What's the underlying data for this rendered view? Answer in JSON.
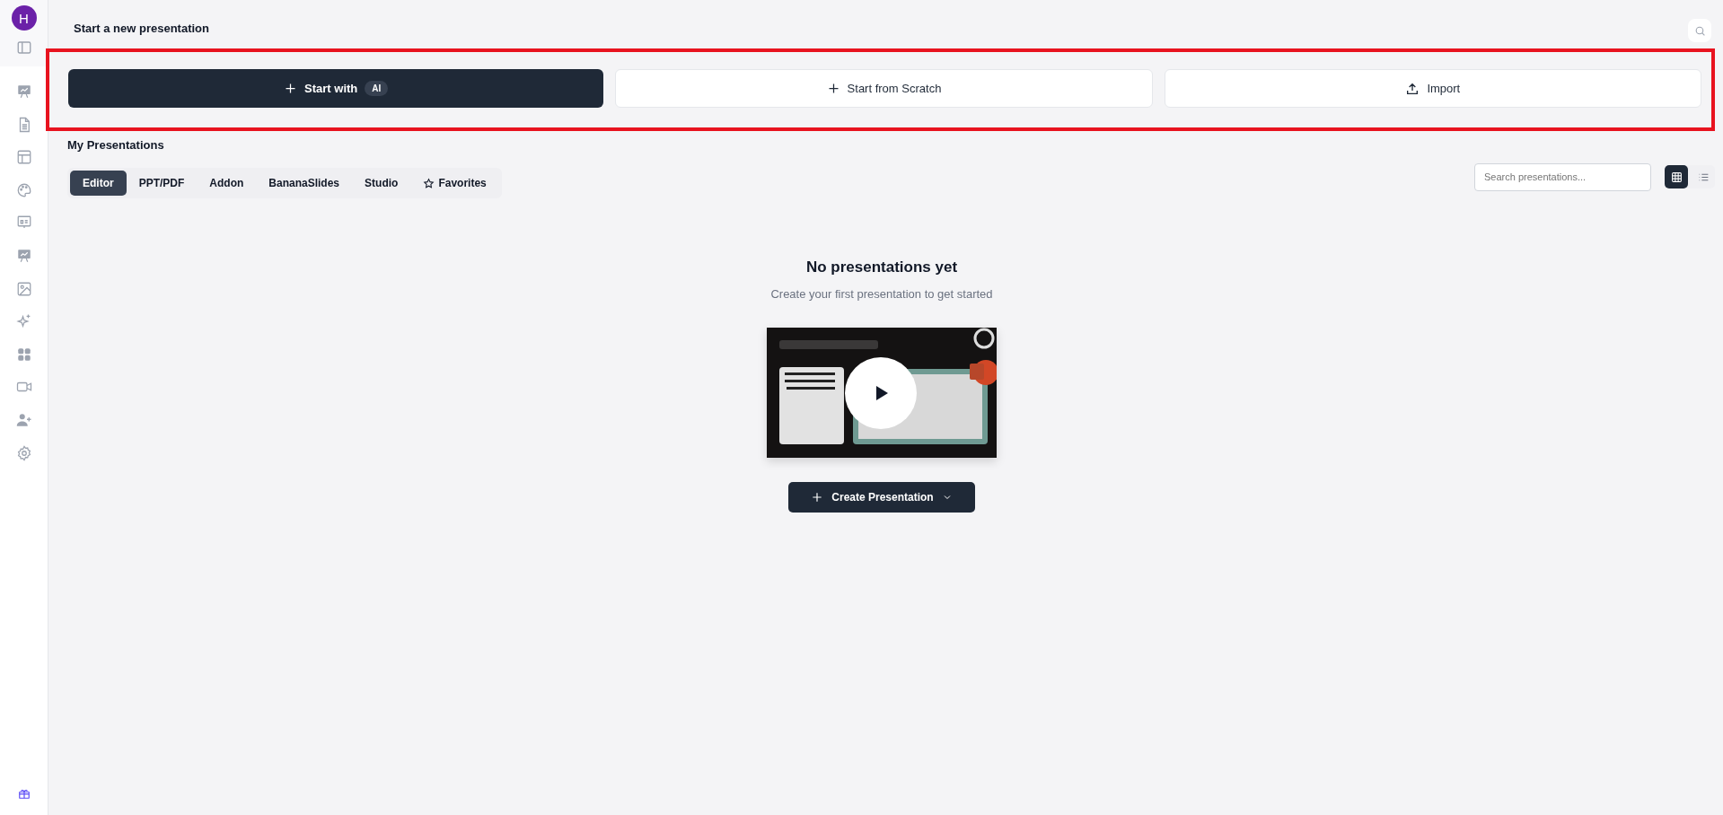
{
  "sidebar": {
    "avatar": "H"
  },
  "header": {
    "title": "Start a new presentation"
  },
  "start_actions": {
    "highlighted": true,
    "buttons": [
      {
        "kind": "ai",
        "label": "Start with",
        "badge": "AI"
      },
      {
        "kind": "scratch",
        "label": "Start from Scratch"
      },
      {
        "kind": "import",
        "label": "Import"
      }
    ]
  },
  "presentations": {
    "title": "My Presentations",
    "tabs": [
      {
        "label": "Editor",
        "selected": true,
        "kind": "plain"
      },
      {
        "label": "PPT/PDF",
        "selected": false,
        "kind": "plain"
      },
      {
        "label": "Addon",
        "selected": false,
        "kind": "plain"
      },
      {
        "label": "BananaSlides",
        "selected": false,
        "kind": "plain"
      },
      {
        "label": "Studio",
        "selected": false,
        "kind": "plain"
      },
      {
        "label": "Favorites",
        "selected": false,
        "kind": "starred"
      }
    ],
    "search": {
      "placeholder": "Search presentations..."
    },
    "view_toggle": [
      {
        "kind": "grid",
        "selected": true
      },
      {
        "kind": "list",
        "selected": false
      }
    ]
  },
  "empty_state": {
    "title": "No presentations yet",
    "subtitle": "Create your first presentation to get started",
    "button": "Create Presentation"
  }
}
